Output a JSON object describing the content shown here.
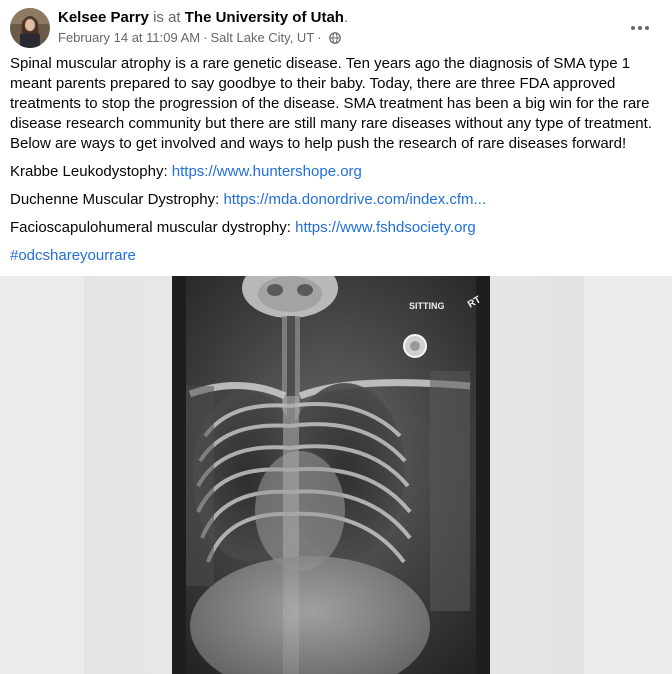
{
  "post": {
    "author": "Kelsee Parry",
    "connector": "is at",
    "place": "The University of Utah",
    "place_suffix": ".",
    "timestamp": "February 14 at 11:09 AM",
    "separator": "·",
    "location": "Salt Lake City, UT",
    "privacy_icon": "globe-icon",
    "more_icon": "more-options-icon",
    "body_text": "Spinal muscular atrophy is a rare genetic disease. Ten years ago the diagnosis of SMA type 1 meant parents prepared to say goodbye to their baby. Today, there are three FDA approved treatments to stop the progression of the disease. SMA treatment has been a big win for the rare disease research community but there are still many rare diseases without any type of treatment. Below are ways to get involved and ways to help push the research of rare diseases forward!",
    "resources": [
      {
        "label": "Krabbe Leukodystophy: ",
        "url": "https://www.huntershope.org"
      },
      {
        "label": "Duchenne Muscular Dystrophy: ",
        "url": "https://mda.donordrive.com/index.cfm..."
      },
      {
        "label": "Facioscapulohumeral muscular dystrophy: ",
        "url": "https://www.fshdsociety.org"
      }
    ],
    "hashtag": "#odcshareyourrare"
  },
  "image": {
    "label_sitting": "SITTING",
    "label_rt": "RT",
    "colors": {
      "background": "#ecebea",
      "film_dark": "#2b2b2b",
      "bone": "#d8d8d8"
    }
  },
  "colors": {
    "link": "#216fdb",
    "secondary_text": "#65676b",
    "primary_text": "#050505"
  }
}
